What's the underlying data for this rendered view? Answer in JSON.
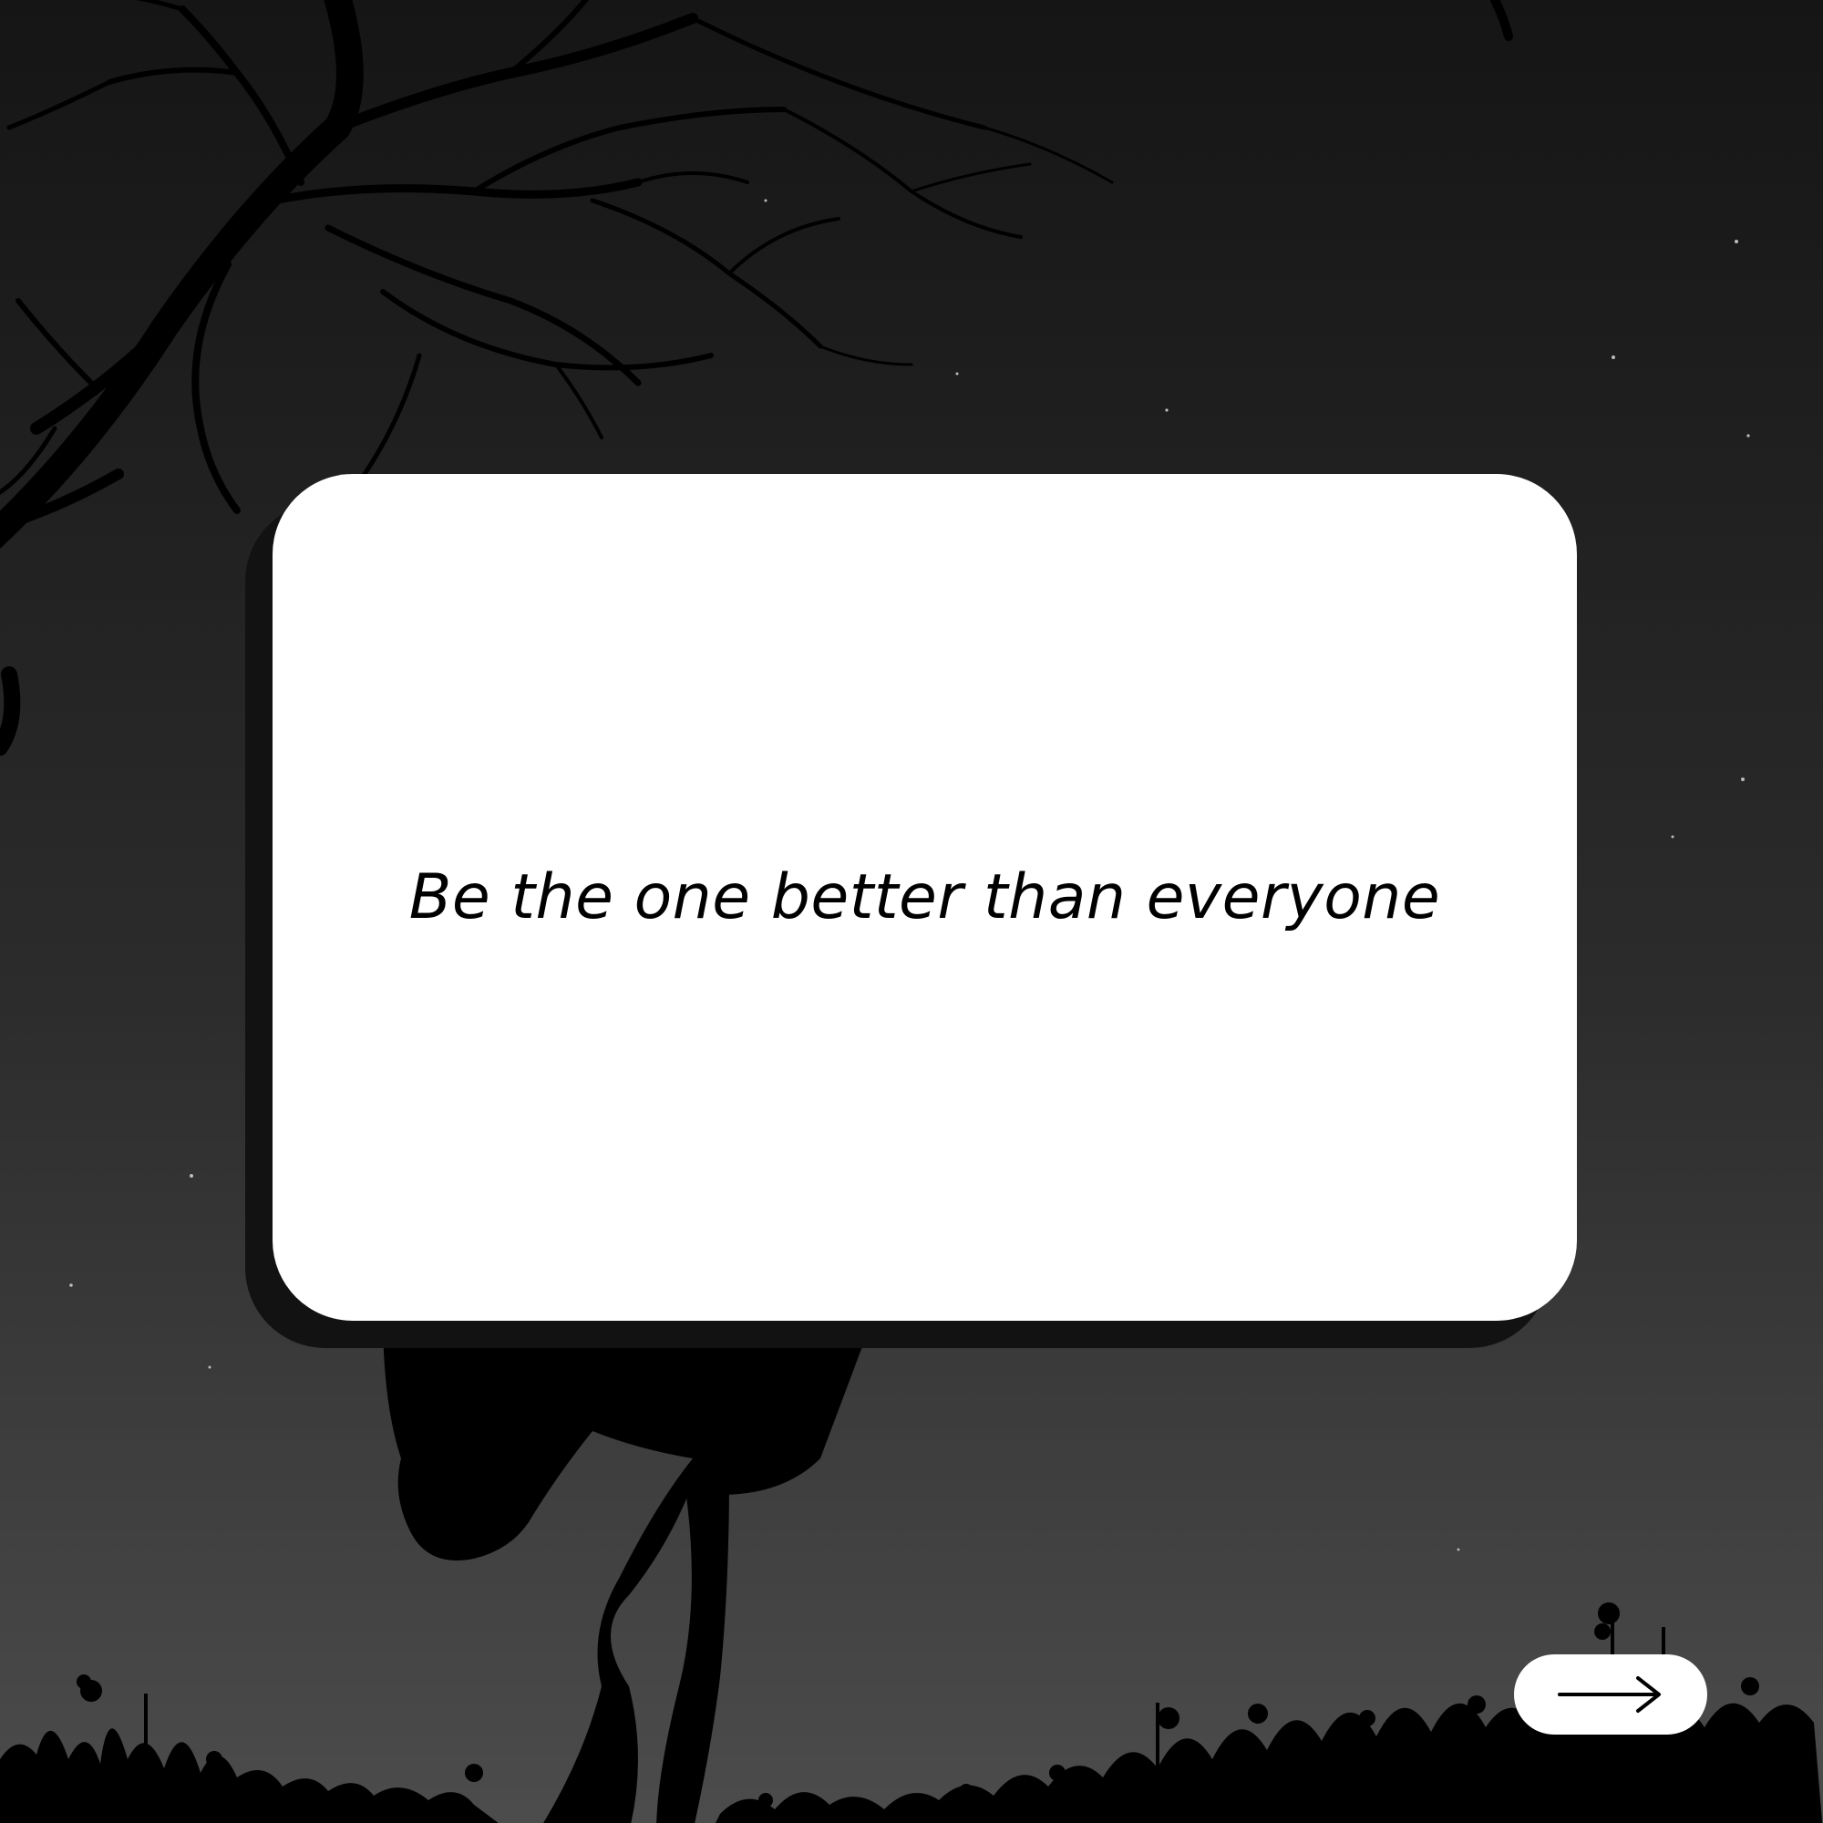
{
  "quote": {
    "text": "Be the one better than everyone"
  },
  "next_button": {
    "icon": "arrow-right-icon"
  },
  "colors": {
    "sky_top": "#151515",
    "sky_bottom": "#4a4a4a",
    "silhouette": "#000000",
    "card": "#ffffff",
    "card_shadow": "#121212",
    "text": "#000000"
  }
}
